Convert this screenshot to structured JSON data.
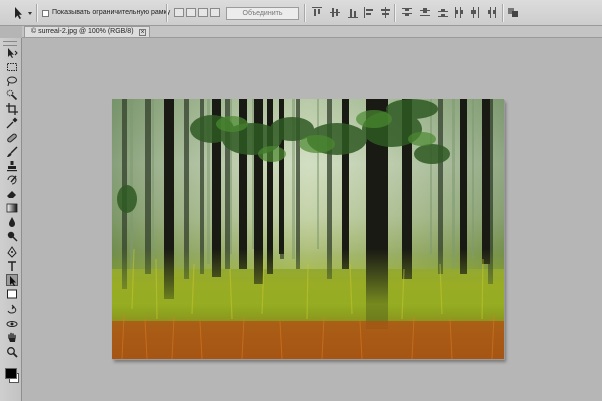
{
  "options_bar": {
    "checkbox_label": "Показывать ограничительную рамку",
    "merge_button_label": "Объединить",
    "checkbox_checked": false
  },
  "document": {
    "tab_title": "© surreal-2.jpg @ 100% (RGB/8)",
    "close_glyph": "×"
  },
  "tools": {
    "icons": [
      "move-tool",
      "marquee-tool",
      "lasso-tool",
      "quick-selection-tool",
      "crop-tool",
      "eyedropper-tool",
      "healing-brush-tool",
      "brush-tool",
      "clone-stamp-tool",
      "history-brush-tool",
      "eraser-tool",
      "gradient-tool",
      "blur-tool",
      "dodge-tool",
      "pen-tool",
      "type-tool",
      "path-selection-tool",
      "shape-tool",
      "3d-rotate-tool",
      "3d-orbit-tool",
      "hand-tool",
      "zoom-tool"
    ],
    "active": "path-selection-tool",
    "foreground_color": "#000000",
    "background_color": "#ffffff"
  },
  "colors": {
    "workspace_bg": "#b6b6b6",
    "panel_bg": "#cdcdcd"
  }
}
